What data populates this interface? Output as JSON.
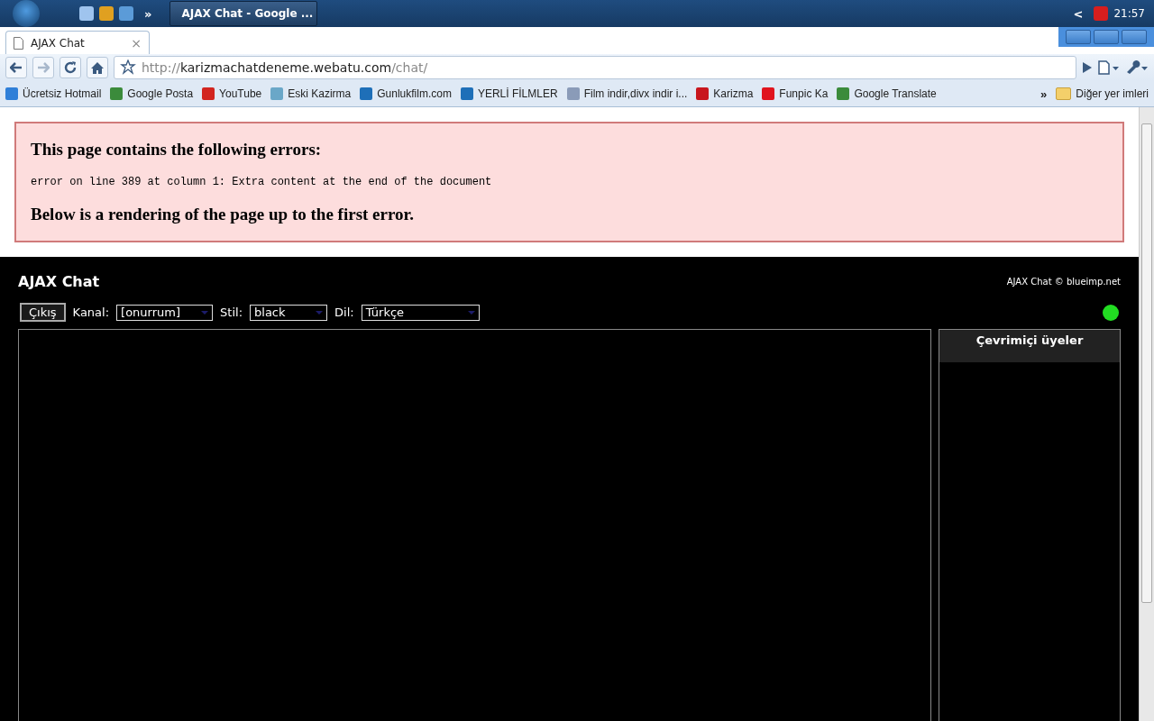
{
  "taskbar": {
    "task_title": "AJAX Chat - Google ...",
    "expand_glyph": "»",
    "tray_arrow": "<",
    "clock": "21:57"
  },
  "browser": {
    "tab": {
      "title": "AJAX Chat",
      "close": "×"
    },
    "address": {
      "scheme": "http://",
      "host": "karizmachatdeneme.webatu.com",
      "path": "/chat/"
    },
    "bookmarks": [
      {
        "label": "Ücretsiz Hotmail",
        "color": "#2f7fd8"
      },
      {
        "label": "Google Posta",
        "color": "#3b8b3b"
      },
      {
        "label": "YouTube",
        "color": "#d2251f"
      },
      {
        "label": "Eski Kazirma",
        "color": "#6aa7c8"
      },
      {
        "label": "Gunlukfilm.com",
        "color": "#1e6fb8"
      },
      {
        "label": "YERLİ FİLMLER",
        "color": "#1e6fb8"
      },
      {
        "label": "Film indir,divx indir i...",
        "color": "#8a9bb8"
      },
      {
        "label": "Karizma",
        "color": "#c8161d"
      },
      {
        "label": "Funpic Ka",
        "color": "#e0141e"
      },
      {
        "label": "Google Translate",
        "color": "#3b8b3b"
      }
    ],
    "more": "»",
    "other": "Diğer yer imleri"
  },
  "error_box": {
    "title": "This page contains the following errors:",
    "message": "error on line 389 at column 1: Extra content at the end of the document",
    "footer": "Below is a rendering of the page up to the first error."
  },
  "chat": {
    "title": "AJAX Chat",
    "credit": "AJAX Chat © blueimp.net",
    "logout": "Çıkış",
    "controls": [
      {
        "label": "Kanal:",
        "value": "[onurrum]"
      },
      {
        "label": "Stil:",
        "value": "black"
      },
      {
        "label": "Dil:",
        "value": "Türkçe"
      }
    ],
    "online": true,
    "online_heading": "Çevrimiçi üyeler"
  }
}
